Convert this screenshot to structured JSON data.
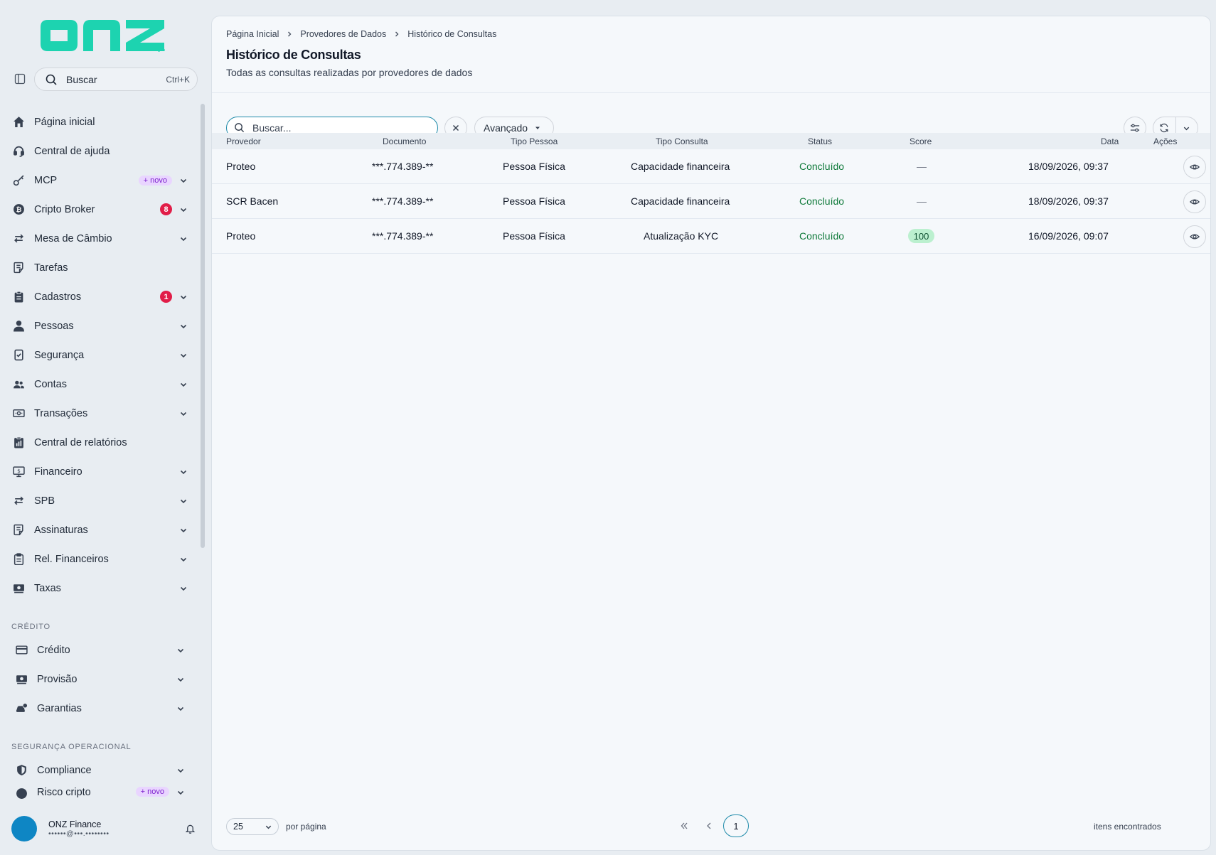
{
  "app": {
    "logo_text": "onz"
  },
  "sidebar": {
    "search": {
      "label": "Buscar",
      "shortcut": "Ctrl+K"
    },
    "items": [
      {
        "label": "Página inicial",
        "icon": "home-icon"
      },
      {
        "label": "Central de ajuda",
        "icon": "headset-icon"
      },
      {
        "label": "MCP",
        "icon": "key-icon",
        "badge": "+ novo",
        "expandable": true
      },
      {
        "label": "Cripto Broker",
        "icon": "bitcoin-icon",
        "count": "8",
        "expandable": true
      },
      {
        "label": "Mesa de Câmbio",
        "icon": "exchange-icon",
        "expandable": true
      },
      {
        "label": "Tarefas",
        "icon": "task-icon"
      },
      {
        "label": "Cadastros",
        "icon": "clipboard-icon",
        "count": "1",
        "expandable": true
      },
      {
        "label": "Pessoas",
        "icon": "person-icon",
        "expandable": true
      },
      {
        "label": "Segurança",
        "icon": "shield-phone-icon",
        "expandable": true
      },
      {
        "label": "Contas",
        "icon": "users-icon",
        "expandable": true
      },
      {
        "label": "Transações",
        "icon": "cash-icon",
        "expandable": true
      },
      {
        "label": "Central de relatórios",
        "icon": "report-icon"
      },
      {
        "label": "Financeiro",
        "icon": "monitor-icon",
        "expandable": true
      },
      {
        "label": "SPB",
        "icon": "exchange-icon",
        "expandable": true
      },
      {
        "label": "Assinaturas",
        "icon": "signature-icon",
        "expandable": true
      },
      {
        "label": "Rel. Financeiros",
        "icon": "clipboard-check-icon",
        "expandable": true
      },
      {
        "label": "Taxas",
        "icon": "money-icon",
        "expandable": true
      }
    ],
    "credit_section": {
      "title": "CRÉDITO",
      "items": [
        {
          "label": "Crédito",
          "icon": "card-icon"
        },
        {
          "label": "Provisão",
          "icon": "money-icon"
        },
        {
          "label": "Garantias",
          "icon": "car-icon"
        }
      ]
    },
    "ops_section": {
      "title": "SEGURANÇA OPERACIONAL",
      "items": [
        {
          "label": "Compliance",
          "icon": "shield-icon"
        },
        {
          "label": "Risco cripto",
          "icon": "alert-icon",
          "badge": "+ novo"
        }
      ]
    },
    "user": {
      "name": "ONZ Finance",
      "email": "••••••@•••.••••••••"
    }
  },
  "header": {
    "breadcrumb": [
      "Página Inicial",
      "Provedores de Dados",
      "Histórico de Consultas"
    ],
    "title": "Histórico de Consultas",
    "subtitle": "Todas as consultas realizadas por provedores de dados"
  },
  "toolbar": {
    "search_placeholder": "Buscar...",
    "advanced_label": "Avançado"
  },
  "table": {
    "columns": [
      "Provedor",
      "Documento",
      "Tipo Pessoa",
      "Tipo Consulta",
      "Status",
      "Score",
      "Data",
      "Ações"
    ],
    "rows": [
      {
        "provedor": "Proteo",
        "documento": "***.774.389-**",
        "tipo_pessoa": "Pessoa Física",
        "tipo_consulta": "Capacidade financeira",
        "status": "Concluído",
        "score": "—",
        "data": "18/09/2026, 09:37"
      },
      {
        "provedor": "SCR Bacen",
        "documento": "***.774.389-**",
        "tipo_pessoa": "Pessoa Física",
        "tipo_consulta": "Capacidade financeira",
        "status": "Concluído",
        "score": "—",
        "data": "18/09/2026, 09:37"
      },
      {
        "provedor": "Proteo",
        "documento": "***.774.389-**",
        "tipo_pessoa": "Pessoa Física",
        "tipo_consulta": "Atualização KYC",
        "status": "Concluído",
        "score": "100",
        "data": "16/09/2026, 09:07"
      }
    ]
  },
  "footer": {
    "per_page": "25",
    "per_page_label": "por página",
    "current_page": "1",
    "found_label": "itens encontrados"
  },
  "colors": {
    "accent": "#1e8aa9",
    "logo": "#1dd3b0",
    "status_ok": "#0f7a3a",
    "badge_red": "#e11d48",
    "badge_new": "#e9d5ff"
  }
}
